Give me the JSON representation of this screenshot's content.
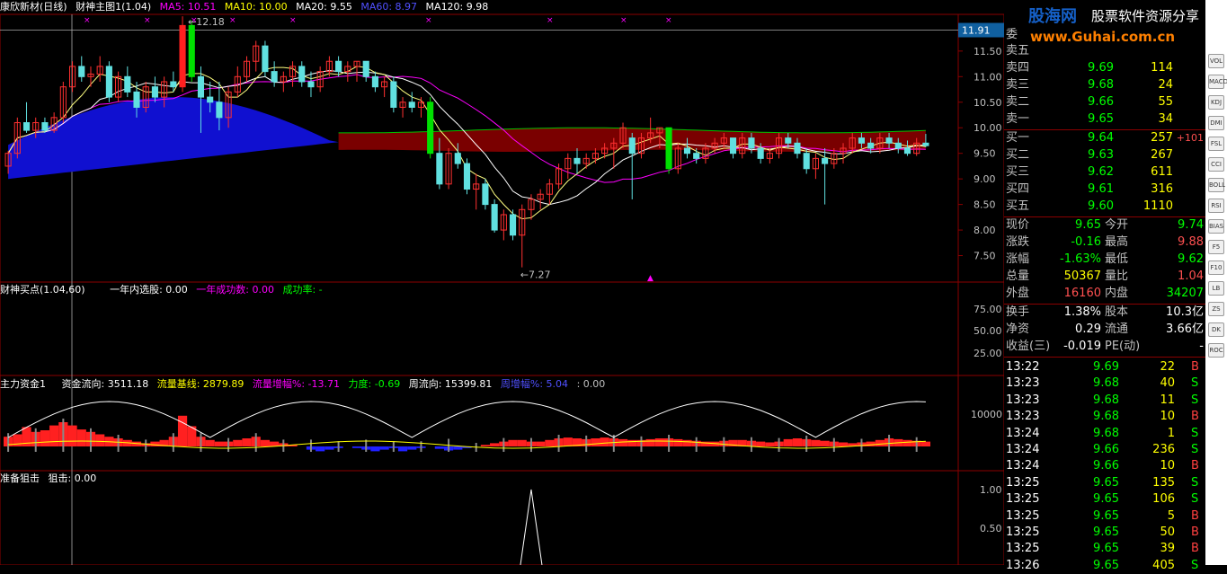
{
  "header": {
    "stock_name": "康欣新材(日线)",
    "indicator": "财神主图1(1.04)",
    "ma": [
      {
        "label": "MA5: 10.51",
        "color": "#ff00ff"
      },
      {
        "label": "MA10: 10.00",
        "color": "#ffff00"
      },
      {
        "label": "MA20: 9.55",
        "color": "#ffffff"
      },
      {
        "label": "MA60: 8.97",
        "color": "#5050ff"
      },
      {
        "label": "MA120: 9.98",
        "color": "#ffffff"
      }
    ]
  },
  "price_axis": [
    "11.91",
    "11.50",
    "11.00",
    "10.50",
    "10.00",
    "9.50",
    "9.00",
    "8.50",
    "8.00",
    "7.50"
  ],
  "annotations": {
    "high": "12.18",
    "low": "7.27"
  },
  "panel2": {
    "title": "财神买点(1.04,60)",
    "items": [
      {
        "label": "一年内选股: 0.00",
        "color": "#ffffff"
      },
      {
        "label": "一年成功数: 0.00",
        "color": "#ff00ff"
      },
      {
        "label": "成功率: -",
        "color": "#00ff00"
      }
    ],
    "axis": [
      "75.00",
      "50.00",
      "25.00"
    ]
  },
  "panel3": {
    "title": "主力资金1",
    "items": [
      {
        "label": "资金流向: 3511.18",
        "color": "#ffffff"
      },
      {
        "label": "流量基线: 2879.89",
        "color": "#ffff00"
      },
      {
        "label": "流量增幅%: -13.71",
        "color": "#ff00ff"
      },
      {
        "label": "力度: -0.69",
        "color": "#00ff00"
      },
      {
        "label": "周流向: 15399.81",
        "color": "#ffffff"
      },
      {
        "label": "周增幅%: 5.04",
        "color": "#5050ff"
      },
      {
        "label": ": 0.00",
        "color": "#c0c0c0"
      }
    ],
    "axis": [
      "10000"
    ]
  },
  "panel4": {
    "title": "准备狙击",
    "items": [
      {
        "label": "狙击: 0.00",
        "color": "#ffffff"
      }
    ],
    "axis": [
      "1.00",
      "0.50"
    ]
  },
  "brand": {
    "logo": "股海网",
    "slogan": "股票软件资源分享",
    "url": "www.Guhai.com.cn"
  },
  "orderbook": {
    "title": "委",
    "sells": [
      {
        "label": "卖五",
        "price": "",
        "vol": ""
      },
      {
        "label": "卖四",
        "price": "9.69",
        "vol": "114"
      },
      {
        "label": "卖三",
        "price": "9.68",
        "vol": "24"
      },
      {
        "label": "卖二",
        "price": "9.66",
        "vol": "55"
      },
      {
        "label": "卖一",
        "price": "9.65",
        "vol": "34"
      }
    ],
    "buys": [
      {
        "label": "买一",
        "price": "9.64",
        "vol": "257",
        "chg": "+101"
      },
      {
        "label": "买二",
        "price": "9.63",
        "vol": "267",
        "chg": ""
      },
      {
        "label": "买三",
        "price": "9.62",
        "vol": "611",
        "chg": ""
      },
      {
        "label": "买四",
        "price": "9.61",
        "vol": "316",
        "chg": ""
      },
      {
        "label": "买五",
        "price": "9.60",
        "vol": "1110",
        "chg": ""
      }
    ]
  },
  "quote": [
    {
      "l1": "现价",
      "v1": "9.65",
      "c1": "#00ff00",
      "l2": "今开",
      "v2": "9.74",
      "c2": "#00ff00"
    },
    {
      "l1": "涨跌",
      "v1": "-0.16",
      "c1": "#00ff00",
      "l2": "最高",
      "v2": "9.88",
      "c2": "#ff5050"
    },
    {
      "l1": "涨幅",
      "v1": "-1.63%",
      "c1": "#00ff00",
      "l2": "最低",
      "v2": "9.62",
      "c2": "#00ff00"
    },
    {
      "l1": "总量",
      "v1": "50367",
      "c1": "#ffff00",
      "l2": "量比",
      "v2": "1.04",
      "c2": "#ff5050"
    },
    {
      "l1": "外盘",
      "v1": "16160",
      "c1": "#ff5050",
      "l2": "内盘",
      "v2": "34207",
      "c2": "#00ff00"
    }
  ],
  "fundamentals": [
    {
      "l1": "换手",
      "v1": "1.38%",
      "l2": "股本",
      "v2": "10.3亿"
    },
    {
      "l1": "净资",
      "v1": "0.29",
      "l2": "流通",
      "v2": "3.66亿"
    },
    {
      "l1": "收益(三)",
      "v1": "-0.019",
      "l2": "PE(动)",
      "v2": "-"
    }
  ],
  "ticks": [
    {
      "time": "13:22",
      "price": "9.69",
      "vol": "22",
      "side": "B"
    },
    {
      "time": "13:23",
      "price": "9.68",
      "vol": "40",
      "side": "S"
    },
    {
      "time": "13:23",
      "price": "9.68",
      "vol": "11",
      "side": "S"
    },
    {
      "time": "13:23",
      "price": "9.68",
      "vol": "10",
      "side": "B"
    },
    {
      "time": "13:24",
      "price": "9.68",
      "vol": "1",
      "side": "S"
    },
    {
      "time": "13:24",
      "price": "9.66",
      "vol": "236",
      "side": "S"
    },
    {
      "time": "13:24",
      "price": "9.66",
      "vol": "10",
      "side": "B"
    },
    {
      "time": "13:25",
      "price": "9.65",
      "vol": "135",
      "side": "S"
    },
    {
      "time": "13:25",
      "price": "9.65",
      "vol": "106",
      "side": "S"
    },
    {
      "time": "13:25",
      "price": "9.65",
      "vol": "5",
      "side": "B"
    },
    {
      "time": "13:25",
      "price": "9.65",
      "vol": "50",
      "side": "B"
    },
    {
      "time": "13:25",
      "price": "9.65",
      "vol": "39",
      "side": "B"
    },
    {
      "time": "13:26",
      "price": "9.65",
      "vol": "405",
      "side": "S"
    }
  ],
  "toolbar": [
    "VOL",
    "MACD",
    "KDJ",
    "DMI",
    "FSL",
    "CCI",
    "BOLL",
    "RSI",
    "BIAS",
    "F5",
    "F10",
    "LB",
    "ZS",
    "DK",
    "ROC"
  ],
  "chart_data": {
    "type": "candlestick",
    "ylim": [
      7.0,
      12.2
    ],
    "yticks": [
      7.5,
      8.0,
      8.5,
      9.0,
      9.5,
      10.0,
      10.5,
      11.0,
      11.5,
      11.91
    ],
    "candles": [
      [
        9.25,
        9.55,
        9.1,
        9.5
      ],
      [
        9.5,
        10.2,
        9.4,
        10.1
      ],
      [
        10.1,
        10.5,
        9.9,
        9.95
      ],
      [
        9.95,
        10.2,
        9.8,
        10.1
      ],
      [
        10.1,
        10.2,
        9.9,
        9.95
      ],
      [
        9.95,
        10.3,
        9.9,
        10.2
      ],
      [
        10.2,
        10.9,
        10.1,
        10.8
      ],
      [
        10.8,
        11.3,
        10.7,
        11.2
      ],
      [
        11.2,
        11.4,
        10.9,
        11.0
      ],
      [
        11.0,
        11.2,
        10.8,
        11.05
      ],
      [
        11.05,
        11.4,
        10.9,
        11.2
      ],
      [
        11.2,
        11.3,
        10.5,
        10.6
      ],
      [
        10.6,
        11.1,
        10.5,
        11.0
      ],
      [
        11.0,
        11.2,
        10.6,
        10.7
      ],
      [
        10.7,
        10.9,
        10.2,
        10.4
      ],
      [
        10.4,
        10.9,
        10.3,
        10.8
      ],
      [
        10.8,
        11.0,
        10.5,
        10.6
      ],
      [
        10.6,
        11.0,
        10.4,
        10.9
      ],
      [
        10.9,
        11.1,
        10.7,
        10.8
      ],
      [
        10.8,
        12.18,
        10.7,
        12.0
      ],
      [
        12.0,
        12.1,
        10.9,
        11.0
      ],
      [
        11.0,
        11.2,
        9.9,
        10.6
      ],
      [
        10.6,
        10.9,
        10.3,
        10.5
      ],
      [
        10.5,
        10.9,
        9.95,
        10.2
      ],
      [
        10.2,
        10.8,
        10.0,
        10.7
      ],
      [
        10.7,
        11.2,
        10.6,
        11.0
      ],
      [
        11.0,
        11.4,
        10.9,
        11.3
      ],
      [
        11.3,
        11.7,
        11.1,
        11.6
      ],
      [
        11.6,
        11.7,
        11.0,
        11.1
      ],
      [
        11.1,
        11.3,
        10.8,
        10.9
      ],
      [
        10.9,
        11.1,
        10.7,
        11.0
      ],
      [
        11.0,
        11.3,
        10.8,
        11.2
      ],
      [
        11.2,
        11.3,
        10.8,
        10.9
      ],
      [
        10.9,
        11.1,
        10.6,
        10.8
      ],
      [
        10.8,
        11.2,
        10.7,
        11.1
      ],
      [
        11.1,
        11.4,
        11.0,
        11.3
      ],
      [
        11.3,
        11.4,
        11.0,
        11.1
      ],
      [
        11.1,
        11.3,
        10.9,
        11.2
      ],
      [
        11.2,
        11.3,
        10.9,
        11.3
      ],
      [
        11.3,
        11.3,
        10.9,
        11.0
      ],
      [
        11.0,
        11.1,
        10.7,
        10.8
      ],
      [
        10.8,
        11.0,
        10.6,
        10.9
      ],
      [
        10.9,
        11.0,
        10.3,
        10.4
      ],
      [
        10.4,
        10.6,
        10.2,
        10.5
      ],
      [
        10.5,
        10.7,
        10.3,
        10.4
      ],
      [
        10.4,
        10.6,
        10.2,
        10.5
      ],
      [
        10.5,
        10.6,
        9.4,
        9.5
      ],
      [
        9.5,
        9.8,
        8.8,
        8.9
      ],
      [
        8.9,
        9.6,
        8.8,
        9.5
      ],
      [
        9.5,
        9.7,
        9.2,
        9.3
      ],
      [
        9.3,
        9.4,
        8.7,
        8.8
      ],
      [
        8.8,
        9.1,
        8.4,
        8.9
      ],
      [
        8.9,
        9.0,
        8.4,
        8.5
      ],
      [
        8.5,
        8.6,
        7.95,
        8.0
      ],
      [
        8.0,
        8.4,
        7.8,
        8.3
      ],
      [
        8.3,
        8.4,
        7.8,
        7.9
      ],
      [
        7.9,
        8.5,
        7.27,
        8.4
      ],
      [
        8.4,
        8.7,
        8.2,
        8.6
      ],
      [
        8.6,
        8.8,
        8.4,
        8.7
      ],
      [
        8.7,
        9.0,
        8.5,
        8.9
      ],
      [
        8.9,
        9.3,
        8.8,
        9.2
      ],
      [
        9.2,
        9.5,
        9.0,
        9.4
      ],
      [
        9.4,
        9.6,
        9.1,
        9.3
      ],
      [
        9.3,
        9.5,
        9.2,
        9.4
      ],
      [
        9.4,
        9.6,
        9.3,
        9.5
      ],
      [
        9.5,
        9.7,
        9.4,
        9.6
      ],
      [
        9.6,
        9.8,
        9.2,
        9.7
      ],
      [
        9.7,
        10.1,
        9.6,
        10.0
      ],
      [
        9.8,
        9.9,
        8.6,
        9.5
      ],
      [
        9.5,
        9.9,
        9.4,
        9.8
      ],
      [
        9.8,
        10.2,
        9.7,
        9.9
      ],
      [
        9.9,
        10.0,
        9.6,
        10.0
      ],
      [
        10.0,
        10.0,
        9.1,
        9.2
      ],
      [
        9.2,
        9.7,
        9.1,
        9.6
      ],
      [
        9.6,
        9.8,
        9.4,
        9.5
      ],
      [
        9.5,
        9.6,
        9.3,
        9.4
      ],
      [
        9.4,
        9.7,
        9.3,
        9.6
      ],
      [
        9.6,
        9.8,
        9.5,
        9.7
      ],
      [
        9.7,
        9.9,
        9.6,
        9.8
      ],
      [
        9.8,
        9.8,
        9.4,
        9.5
      ],
      [
        9.5,
        9.9,
        9.4,
        9.8
      ],
      [
        9.8,
        9.9,
        9.5,
        9.6
      ],
      [
        9.6,
        9.7,
        9.3,
        9.4
      ],
      [
        9.4,
        9.6,
        9.3,
        9.5
      ],
      [
        9.5,
        9.9,
        9.4,
        9.8
      ],
      [
        9.8,
        9.9,
        9.6,
        9.7
      ],
      [
        9.7,
        9.8,
        9.4,
        9.5
      ],
      [
        9.5,
        9.6,
        9.1,
        9.2
      ],
      [
        9.2,
        9.5,
        9.0,
        9.4
      ],
      [
        9.4,
        9.6,
        8.5,
        9.3
      ],
      [
        9.3,
        9.6,
        9.2,
        9.5
      ],
      [
        9.5,
        9.7,
        9.3,
        9.6
      ],
      [
        9.6,
        9.9,
        9.5,
        9.8
      ],
      [
        9.8,
        9.9,
        9.6,
        9.7
      ],
      [
        9.7,
        9.8,
        9.5,
        9.6
      ],
      [
        9.6,
        9.9,
        9.5,
        9.8
      ],
      [
        9.8,
        9.9,
        9.6,
        9.7
      ],
      [
        9.7,
        9.8,
        9.5,
        9.6
      ],
      [
        9.6,
        9.75,
        9.45,
        9.5
      ],
      [
        9.5,
        9.8,
        9.45,
        9.7
      ],
      [
        9.7,
        9.88,
        9.62,
        9.65
      ]
    ],
    "money_flow": [
      120,
      150,
      240,
      180,
      200,
      260,
      300,
      260,
      210,
      180,
      150,
      120,
      100,
      80,
      60,
      40,
      60,
      80,
      120,
      380,
      250,
      120,
      80,
      60,
      60,
      80,
      100,
      120,
      80,
      60,
      40,
      20,
      0,
      -40,
      -60,
      -40,
      -20,
      0,
      -20,
      -40,
      -60,
      -40,
      -20,
      -60,
      -40,
      -20,
      0,
      -30,
      -50,
      -40,
      -20,
      0,
      20,
      40,
      60,
      80,
      80,
      60,
      60,
      80,
      100,
      110,
      100,
      90,
      100,
      110,
      100,
      90,
      80,
      80,
      90,
      100,
      100,
      90,
      80,
      70,
      60,
      60,
      70,
      80,
      80,
      70,
      60,
      50,
      60,
      90,
      100,
      90,
      80,
      70,
      60,
      50,
      40,
      50,
      60,
      80,
      100,
      90,
      80,
      70,
      60
    ]
  }
}
